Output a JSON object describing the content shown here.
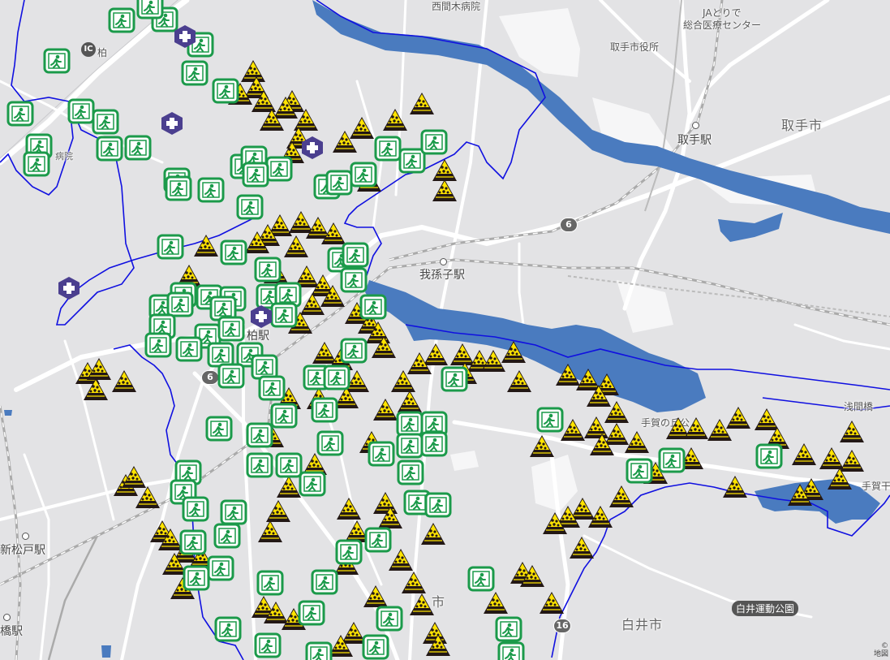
{
  "labels": {
    "nishi_hospital": "西間木病院",
    "ja_line1": "JAとりで",
    "ja_line2": "総合医療センター",
    "toride_office": "取手市役所",
    "toride_city": "取手市",
    "toride_station": "取手駅",
    "abiko_station": "我孫子駅",
    "kashiwa_station": "柏駅",
    "kashiwa_ic": "柏",
    "hospital_partial": "病院",
    "teganuma_label": "手賀の丘公",
    "asama_bridge": "浅間橋",
    "tega_label": "手賀干",
    "shinmatsudo_station": "新松戸駅",
    "hashi_station": "橋駅",
    "city_partial": "市",
    "shiroi_city": "白井市",
    "shiroi_park": "白井運動公園",
    "attribution_1": "©",
    "attribution_2": "地図"
  },
  "route_badges": {
    "r6_top": "6",
    "r6_left": "6",
    "r16": "16",
    "ic": "IC"
  },
  "colors": {
    "background": "#e3e3e5",
    "water": "#4a7bbf",
    "boundary": "#0000ee",
    "road": "#ffffff",
    "evacuation_green": "#1b9a4a",
    "landslide_yellow": "#ffe400",
    "medical_purple": "#4b3f8f"
  },
  "markers": {
    "evacuation_icon": "evacuation-site-icon",
    "landslide_icon": "landslide-warning-icon",
    "medical_icon": "medical-facility-icon"
  }
}
